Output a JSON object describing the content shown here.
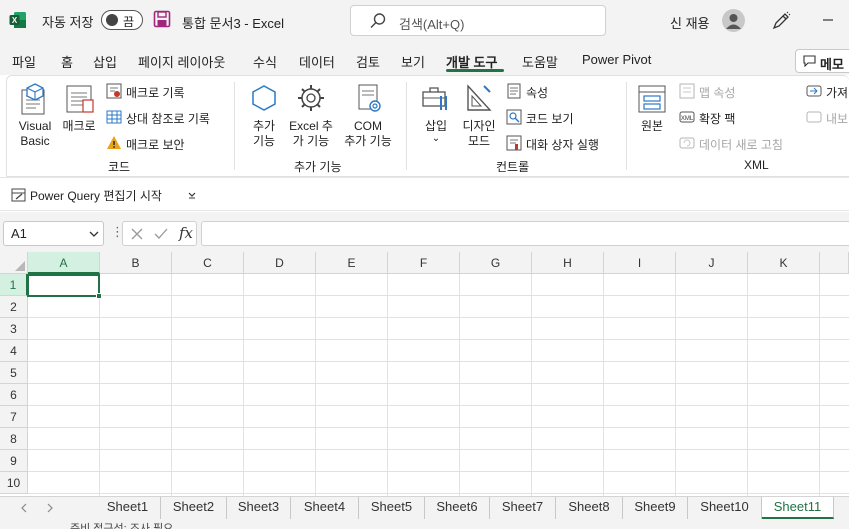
{
  "titlebar": {
    "autosave_label": "자동 저장",
    "autosave_state": "끔",
    "doc_title": "통합 문서3  -  Excel",
    "search_placeholder": "검색(Alt+Q)",
    "user_name": "신 재용"
  },
  "tabs": [
    {
      "label": "파일"
    },
    {
      "label": "홈"
    },
    {
      "label": "삽입"
    },
    {
      "label": "페이지 레이아웃"
    },
    {
      "label": "수식"
    },
    {
      "label": "데이터"
    },
    {
      "label": "검토"
    },
    {
      "label": "보기"
    },
    {
      "label": "개발 도구",
      "active": true
    },
    {
      "label": "도움말"
    },
    {
      "label": "Power Pivot"
    }
  ],
  "memo_label": "메모",
  "ribbon": {
    "code": {
      "visual_basic": "Visual\nBasic",
      "macro": "매크로",
      "record_macro": "매크로 기록",
      "relative_ref": "상대 참조로 기록",
      "macro_security": "매크로 보안",
      "group_label": "코드"
    },
    "addins": {
      "addins": "추가\n기능",
      "excel_addins": "Excel 추\n가 기능",
      "com_addins": "COM\n추가 기능",
      "group_label": "추가 기능"
    },
    "controls": {
      "insert": "삽입",
      "design_mode": "디자인\n모드",
      "properties": "속성",
      "view_code": "코드 보기",
      "run_dialog": "대화 상자 실행",
      "group_label": "컨트롤"
    },
    "xml": {
      "source": "원본",
      "map_properties": "맵 속성",
      "expansion_packs": "확장 팩",
      "refresh_data": "데이터 새로 고침",
      "import": "가져",
      "export": "내보",
      "group_label": "XML"
    }
  },
  "pq_bar": {
    "label": "Power Query 편집기 시작"
  },
  "formula_bar": {
    "name_box": "A1",
    "fx": "fx",
    "dots": "⋮"
  },
  "grid": {
    "columns": [
      "A",
      "B",
      "C",
      "D",
      "E",
      "F",
      "G",
      "H",
      "I",
      "J",
      "K"
    ],
    "rows": [
      "1",
      "2",
      "3",
      "4",
      "5",
      "6",
      "7",
      "8",
      "9",
      "10"
    ],
    "selected_cell": "A1"
  },
  "sheets": [
    "Sheet1",
    "Sheet2",
    "Sheet3",
    "Sheet4",
    "Sheet5",
    "Sheet6",
    "Sheet7",
    "Sheet8",
    "Sheet9",
    "Sheet10",
    "Sheet11"
  ],
  "active_sheet": "Sheet11",
  "status": {
    "text": "준비   접근성: 조사 필요"
  },
  "colors": {
    "accent": "#217346",
    "excel_green": "#107c41",
    "save_purple": "#a0277d",
    "icon_blue": "#2b79c7",
    "warning": "#e8a317"
  }
}
